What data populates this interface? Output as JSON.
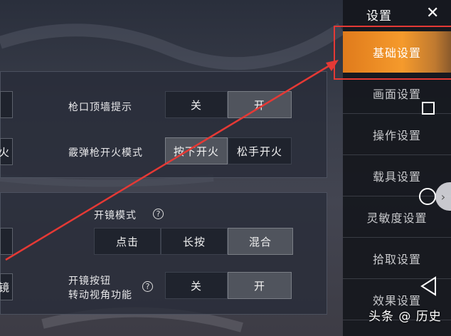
{
  "sidebar": {
    "title": "设置",
    "items": [
      {
        "label": "基础设置",
        "active": true
      },
      {
        "label": "画面设置"
      },
      {
        "label": "操作设置"
      },
      {
        "label": "载具设置"
      },
      {
        "label": "灵敏度设置"
      },
      {
        "label": "拾取设置"
      },
      {
        "label": "效果设置"
      }
    ]
  },
  "settings": {
    "muzzle_wall_hint": {
      "label": "枪口顶墙提示",
      "options": [
        "关",
        "开"
      ],
      "selected": "开"
    },
    "shotgun_fire_mode": {
      "label": "霰弹枪开火模式",
      "options": [
        "按下开火",
        "松手开火"
      ],
      "selected": "按下开火"
    },
    "scope_mode": {
      "label": "开镜模式",
      "options": [
        "点击",
        "长按",
        "混合"
      ],
      "selected": "混合"
    },
    "scope_button_rotate": {
      "label_line1": "开镜按钮",
      "label_line2": "转动视角功能",
      "options": [
        "关",
        "开"
      ],
      "selected": "开"
    },
    "left_cut_1": "火",
    "left_cut_2": "镜"
  },
  "watermark": "头条 @ 历史",
  "colors": {
    "accent": "#f59a2c",
    "annotation": "#e53935"
  }
}
